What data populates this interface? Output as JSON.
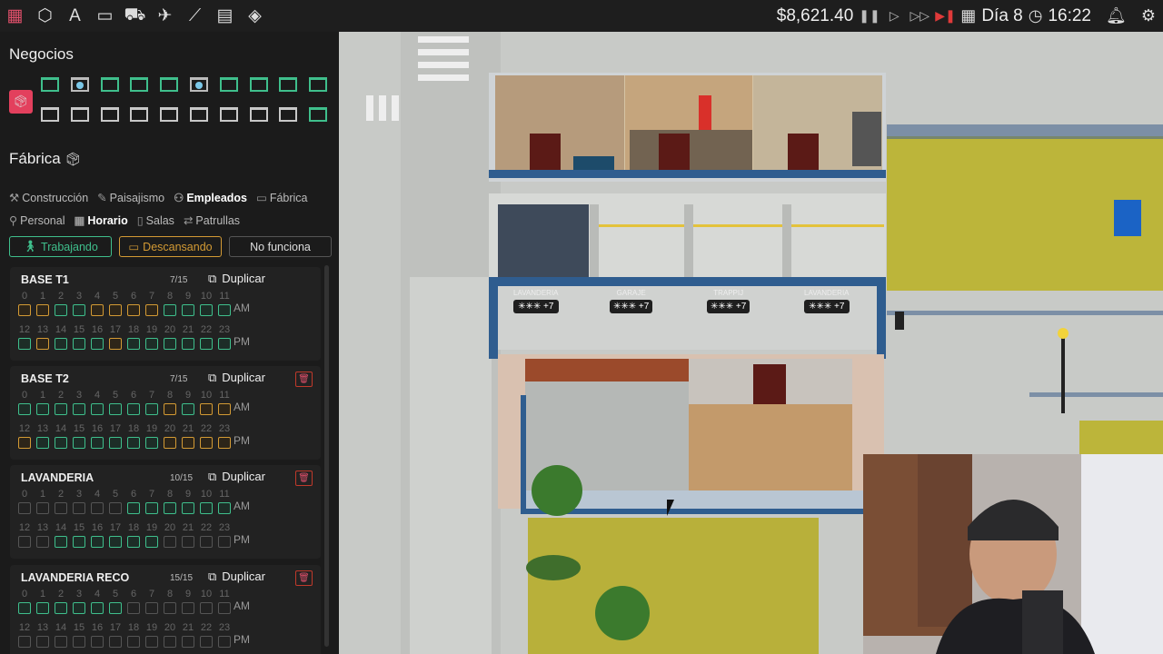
{
  "topbar": {
    "icons": [
      "grid-icon",
      "cube-network-icon",
      "text-a-icon",
      "briefcase-icon",
      "truck-icon",
      "plane-icon",
      "chart-icon",
      "notebook-icon",
      "layers-icon"
    ],
    "money": "$8,621.40",
    "day": "Día 8",
    "time": "16:22"
  },
  "panel": {
    "businesses_title": "Negocios",
    "factory_title": "Fábrica",
    "tabs_row1": [
      "Construcción",
      "Paisajismo",
      "Empleados",
      "Fábrica"
    ],
    "tabs_row2": [
      "Personal",
      "Horario",
      "Salas",
      "Patrullas"
    ],
    "filters": {
      "working": "Trabajando",
      "resting": "Descansando",
      "not_working": "No funciona"
    },
    "duplicate_label": "Duplicar",
    "am": "AM",
    "pm": "PM",
    "hours_am": [
      "0",
      "1",
      "2",
      "3",
      "4",
      "5",
      "6",
      "7",
      "8",
      "9",
      "10",
      "11"
    ],
    "hours_pm": [
      "12",
      "13",
      "14",
      "15",
      "16",
      "17",
      "18",
      "19",
      "20",
      "21",
      "22",
      "23"
    ],
    "schedules": [
      {
        "name": "BASE T1",
        "count": "7/15",
        "deletable": false,
        "am": [
          "r",
          "r",
          "w",
          "w",
          "r",
          "r",
          "r",
          "r",
          "w",
          "w",
          "w",
          "w"
        ],
        "pm": [
          "w",
          "r",
          "w",
          "w",
          "w",
          "r",
          "w",
          "w",
          "w",
          "w",
          "w",
          "w"
        ]
      },
      {
        "name": "BASE T2",
        "count": "7/15",
        "deletable": true,
        "am": [
          "w",
          "w",
          "w",
          "w",
          "w",
          "w",
          "w",
          "w",
          "r",
          "w",
          "r",
          "r"
        ],
        "pm": [
          "r",
          "w",
          "w",
          "w",
          "w",
          "w",
          "w",
          "w",
          "r",
          "r",
          "r",
          "r"
        ]
      },
      {
        "name": "LAVANDERIA",
        "count": "10/15",
        "deletable": true,
        "am": [
          "o",
          "o",
          "o",
          "o",
          "o",
          "o",
          "w",
          "w",
          "w",
          "w",
          "w",
          "w"
        ],
        "pm": [
          "o",
          "o",
          "w",
          "w",
          "w",
          "w",
          "w",
          "w",
          "o",
          "o",
          "o",
          "o"
        ]
      },
      {
        "name": "LAVANDERIA RECO",
        "count": "15/15",
        "deletable": true,
        "am": [
          "w",
          "w",
          "w",
          "w",
          "w",
          "w",
          "o",
          "o",
          "o",
          "o",
          "o",
          "o"
        ],
        "pm": [
          "o",
          "o",
          "o",
          "o",
          "o",
          "o",
          "o",
          "o",
          "o",
          "o",
          "o",
          "o"
        ]
      }
    ]
  },
  "world": {
    "room_labels": [
      {
        "name": "LAVANDERIA",
        "extra": "+7"
      },
      {
        "name": "GARAJE",
        "extra": "+7"
      },
      {
        "name": "TRAPPIJ",
        "extra": "+7"
      },
      {
        "name": "LAVANDERIA",
        "extra": "+7"
      }
    ]
  },
  "colors": {
    "working": "#3fbf8c",
    "resting": "#d39a34",
    "accent": "#e3405d"
  }
}
